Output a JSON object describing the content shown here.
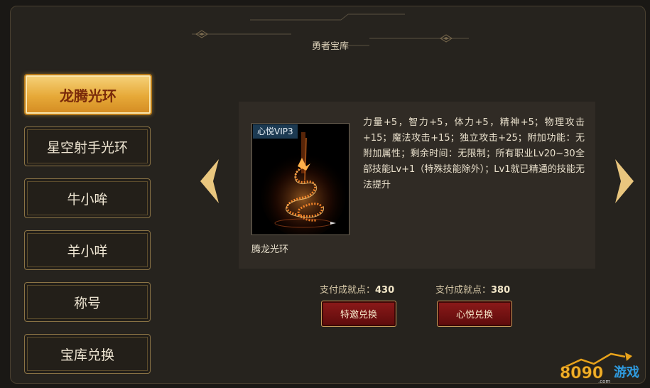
{
  "window": {
    "title": "勇者宝库"
  },
  "nav": {
    "items": [
      {
        "label": "龙腾光环",
        "active": true
      },
      {
        "label": "星空射手光环",
        "active": false
      },
      {
        "label": "牛小哞",
        "active": false
      },
      {
        "label": "羊小咩",
        "active": false
      },
      {
        "label": "称号",
        "active": false
      },
      {
        "label": "宝库兑换",
        "active": false
      }
    ]
  },
  "item": {
    "tag": "心悦VIP3",
    "name": "腾龙光环",
    "description": "力量+5，智力+5，体力+5，精神+5；物理攻击+15；魔法攻击+15；独立攻击+25；附加功能：无附加属性；剩余时间：无限制；所有职业Lv20~30全部技能Lv+1（特殊技能除外）；Lv1就已精通的技能无法提升"
  },
  "exchange": [
    {
      "cost_label": "支付成就点：",
      "cost_value": "430",
      "button": "特邀兑换"
    },
    {
      "cost_label": "支付成就点：",
      "cost_value": "380",
      "button": "心悦兑换"
    }
  ],
  "icons": {
    "prev": "chevron-left-icon",
    "next": "chevron-right-icon"
  },
  "colors": {
    "accent_gold": "#e6a938",
    "button_red": "#7a1414",
    "arrow_gold": "#e9c67e"
  },
  "watermark": {
    "text": "8090游戏",
    "sub": ".com"
  }
}
